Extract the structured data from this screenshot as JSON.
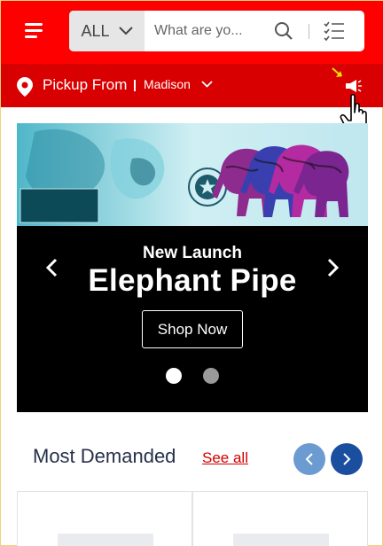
{
  "header": {
    "menu_icon": "hamburger-menu-icon",
    "category": "ALL",
    "search_placeholder": "What are yo...",
    "search_icon": "search-icon",
    "list_icon": "checklist-icon"
  },
  "location": {
    "label": "Pickup From",
    "store": "Madison",
    "pin_icon": "location-pin-icon",
    "announce_icon": "megaphone-icon"
  },
  "banner": {
    "subtitle": "New Launch",
    "title": "Elephant Pipe",
    "cta": "Shop Now",
    "slide_count": 2,
    "active_slide": 1
  },
  "section": {
    "title": "Most Demanded",
    "see_all": "See all"
  },
  "products": [
    {
      "name": ""
    },
    {
      "name": ""
    }
  ],
  "colors": {
    "header_red": "#ff0000",
    "location_red": "#d80000",
    "nav_prev": "#6b9bd1",
    "nav_next": "#1a4fa0"
  }
}
